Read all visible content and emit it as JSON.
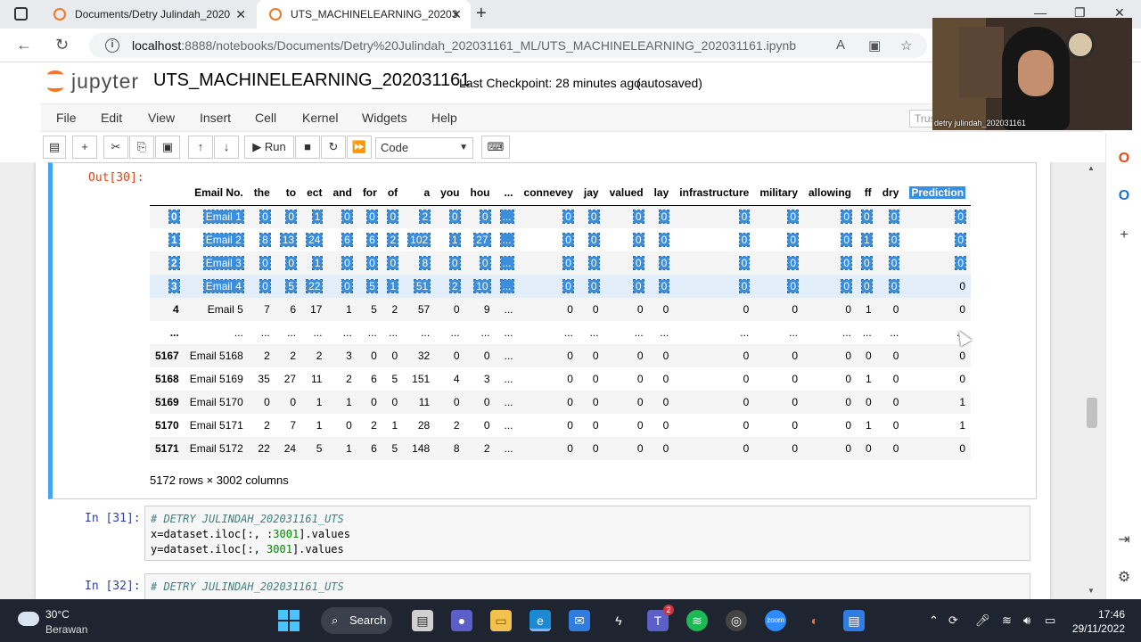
{
  "browser": {
    "tabs": [
      {
        "title": "Documents/Detry Julindah_2020"
      },
      {
        "title": "UTS_MACHINELEARNING_20203"
      }
    ],
    "url_host": "localhost",
    "url_rest": ":8888/notebooks/Documents/Detry%20Julindah_202031161_ML/UTS_MACHINELEARNING_202031161.ipynb"
  },
  "jupyter": {
    "brand": "jupyter",
    "notebook_title": "UTS_MACHINELEARNING_202031161",
    "checkpoint": "Last Checkpoint: 28 minutes ago",
    "autosave": "(autosaved)",
    "trusted": "Trus",
    "menu": [
      "File",
      "Edit",
      "View",
      "Insert",
      "Cell",
      "Kernel",
      "Widgets",
      "Help"
    ],
    "toolbar": {
      "run_label": "Run",
      "cell_type": "Code"
    }
  },
  "output": {
    "prompt": "Out[30]:",
    "columns": [
      "",
      "Email No.",
      "the",
      "to",
      "ect",
      "and",
      "for",
      "of",
      "a",
      "you",
      "hou",
      "...",
      "connevey",
      "jay",
      "valued",
      "lay",
      "infrastructure",
      "military",
      "allowing",
      "ff",
      "dry",
      "Prediction"
    ],
    "rows": [
      [
        "0",
        "Email 1",
        "0",
        "0",
        "1",
        "0",
        "0",
        "0",
        "2",
        "0",
        "0",
        "...",
        "0",
        "0",
        "0",
        "0",
        "0",
        "0",
        "0",
        "0",
        "0",
        "0"
      ],
      [
        "1",
        "Email 2",
        "8",
        "13",
        "24",
        "6",
        "6",
        "2",
        "102",
        "1",
        "27",
        "...",
        "0",
        "0",
        "0",
        "0",
        "0",
        "0",
        "0",
        "1",
        "0",
        "0"
      ],
      [
        "2",
        "Email 3",
        "0",
        "0",
        "1",
        "0",
        "0",
        "0",
        "8",
        "0",
        "0",
        "...",
        "0",
        "0",
        "0",
        "0",
        "0",
        "0",
        "0",
        "0",
        "0",
        "0"
      ],
      [
        "3",
        "Email 4",
        "0",
        "5",
        "22",
        "0",
        "5",
        "1",
        "51",
        "2",
        "10",
        "...",
        "0",
        "0",
        "0",
        "0",
        "0",
        "0",
        "0",
        "0",
        "0",
        "0"
      ],
      [
        "4",
        "Email 5",
        "7",
        "6",
        "17",
        "1",
        "5",
        "2",
        "57",
        "0",
        "9",
        "...",
        "0",
        "0",
        "0",
        "0",
        "0",
        "0",
        "0",
        "1",
        "0",
        "0"
      ],
      [
        "...",
        "...",
        "...",
        "...",
        "...",
        "...",
        "...",
        "...",
        "...",
        "...",
        "...",
        "...",
        "...",
        "...",
        "...",
        "...",
        "...",
        "...",
        "...",
        "...",
        "...",
        "..."
      ],
      [
        "5167",
        "Email 5168",
        "2",
        "2",
        "2",
        "3",
        "0",
        "0",
        "32",
        "0",
        "0",
        "...",
        "0",
        "0",
        "0",
        "0",
        "0",
        "0",
        "0",
        "0",
        "0",
        "0"
      ],
      [
        "5168",
        "Email 5169",
        "35",
        "27",
        "11",
        "2",
        "6",
        "5",
        "151",
        "4",
        "3",
        "...",
        "0",
        "0",
        "0",
        "0",
        "0",
        "0",
        "0",
        "1",
        "0",
        "0"
      ],
      [
        "5169",
        "Email 5170",
        "0",
        "0",
        "1",
        "1",
        "0",
        "0",
        "11",
        "0",
        "0",
        "...",
        "0",
        "0",
        "0",
        "0",
        "0",
        "0",
        "0",
        "0",
        "0",
        "1"
      ],
      [
        "5170",
        "Email 5171",
        "2",
        "7",
        "1",
        "0",
        "2",
        "1",
        "28",
        "2",
        "0",
        "...",
        "0",
        "0",
        "0",
        "0",
        "0",
        "0",
        "0",
        "1",
        "0",
        "1"
      ],
      [
        "5171",
        "Email 5172",
        "22",
        "24",
        "5",
        "1",
        "6",
        "5",
        "148",
        "8",
        "2",
        "...",
        "0",
        "0",
        "0",
        "0",
        "0",
        "0",
        "0",
        "0",
        "0",
        "0"
      ]
    ],
    "shape": "5172 rows × 3002 columns"
  },
  "cells": [
    {
      "prompt": "In [31]:",
      "lines": [
        {
          "comment": "# DETRY JULINDAH_202031161_UTS"
        },
        {
          "pre": "x=dataset.iloc[:, :",
          "num": "3001",
          "post": "].values"
        },
        {
          "pre": "y=dataset.iloc[:, ",
          "num": "3001",
          "post": "].values"
        }
      ]
    },
    {
      "prompt": "In [32]:",
      "lines": [
        {
          "comment": "# DETRY JULINDAH_202031161_UTS"
        }
      ]
    }
  ],
  "webcam": {
    "name": "detry julindah_202031161"
  },
  "taskbar": {
    "temperature": "30°C",
    "condition": "Berawan",
    "search_label": "Search",
    "time": "17:46",
    "date": "29/11/2022",
    "teams_badge": "2"
  },
  "colors": {
    "accent": "#42a5f5",
    "selection": "#3b8edb",
    "out_prompt": "#d84315",
    "in_prompt": "#303f9f"
  }
}
